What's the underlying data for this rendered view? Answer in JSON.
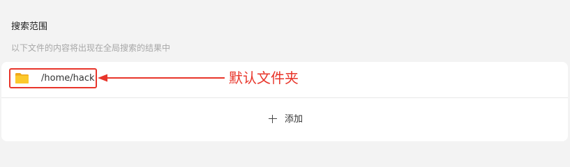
{
  "section": {
    "title": "搜索范围",
    "description": "以下文件的内容将出现在全局搜索的结果中"
  },
  "folders": [
    {
      "path": "/home/hack",
      "icon": "folder-icon"
    }
  ],
  "add_button": {
    "icon": "plus-icon",
    "label": "添加"
  },
  "annotation": {
    "label": "默认文件夹",
    "color": "#e8352a"
  },
  "colors": {
    "background": "#f3f3f3",
    "card": "#ffffff",
    "folder_yellow": "#f5bd1f",
    "annotation_red": "#e8352a"
  }
}
